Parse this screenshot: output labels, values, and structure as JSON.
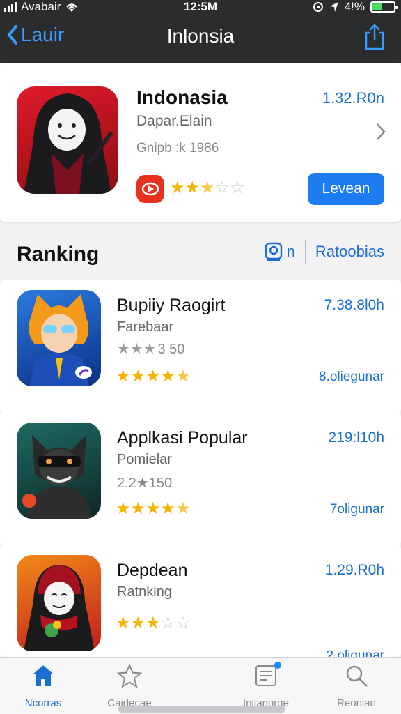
{
  "status": {
    "carrier": "Avabair",
    "time": "12:5M",
    "battery": "4!%",
    "battery_level": 0.45
  },
  "nav": {
    "back_label": "Lauir",
    "title": "Inlonsia"
  },
  "featured": {
    "name": "Indonasia",
    "developer": "Dapar.Elain",
    "rank": "Gnipb :k 1986",
    "price": "1.32.R0n",
    "rating": 2.5,
    "button": "Levean"
  },
  "section": {
    "title": "Ranking",
    "filter_label": "n",
    "link": "Ratoobias"
  },
  "apps": [
    {
      "name": "Bupiiy Raogirt",
      "subtitle": "Farebaar",
      "meta_value": "3 50",
      "meta_stars": 3,
      "rating": 4.5,
      "price": "7.38.8l0h",
      "category": "8.oliegunar"
    },
    {
      "name": "Applkasi Popular",
      "subtitle": "Pomielar",
      "meta_value": "2.2★150",
      "meta_stars": 0,
      "rating": 4.5,
      "price": "219:l10h",
      "category": "7oligunar"
    },
    {
      "name": "Depdean",
      "subtitle": "Ratnking",
      "meta_value": "",
      "meta_stars": 0,
      "rating": 3,
      "price": "1.29.R0h",
      "category": "2.oligunar"
    }
  ],
  "tabs": [
    {
      "label": "Ncorras",
      "icon": "home-icon"
    },
    {
      "label": "Caidecae",
      "icon": "star-icon"
    },
    {
      "label": "Iniianorge",
      "icon": "list-icon"
    },
    {
      "label": "Reonian",
      "icon": "search-icon"
    }
  ],
  "colors": {
    "accent": "#1a6fd1",
    "button": "#1d7cf2",
    "star": "#f5b400",
    "nav_bg": "#2b2c2e"
  }
}
